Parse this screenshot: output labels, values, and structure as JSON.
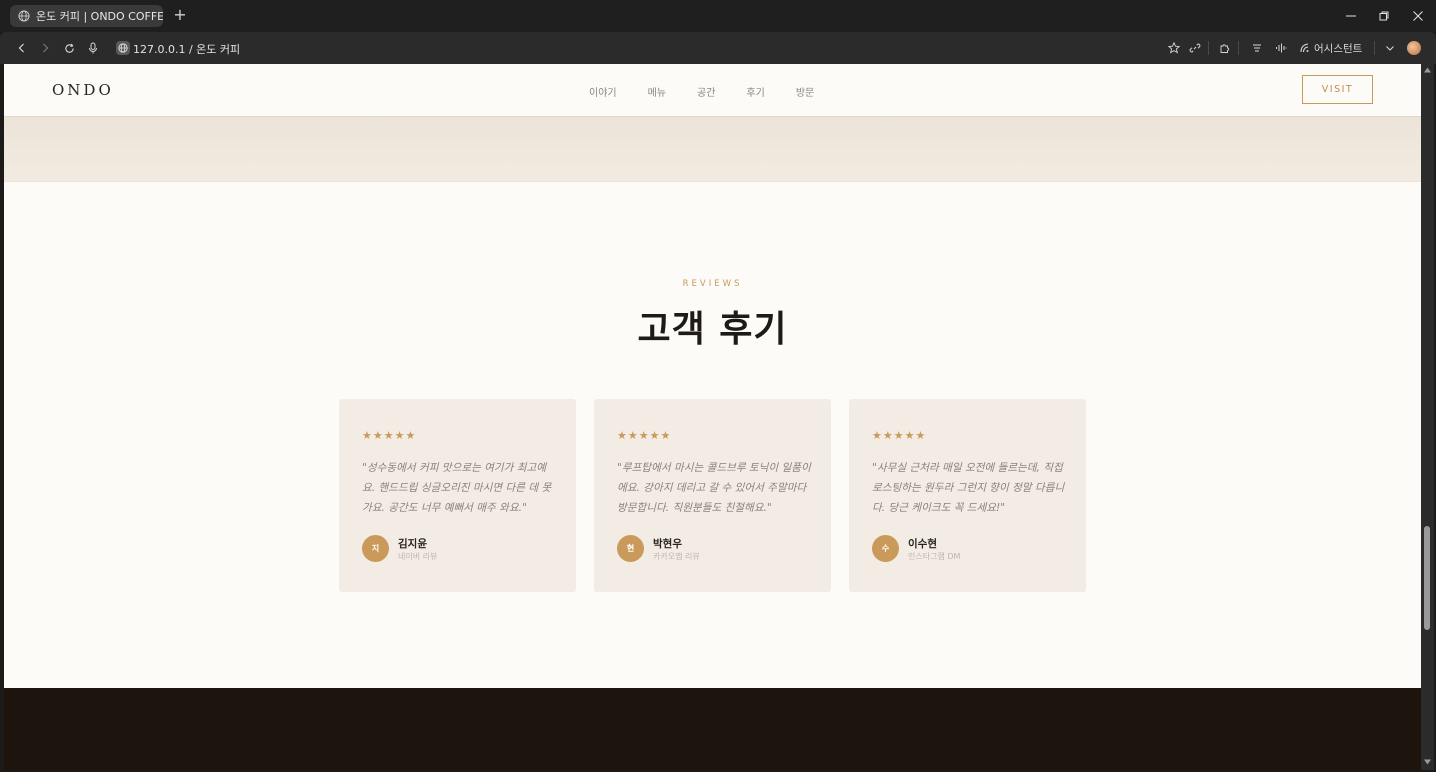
{
  "browser": {
    "tab_title": "온도 커피 | ONDO COFFEE",
    "url": "127.0.0.1 / 온도 커피",
    "assistant_label": "어시스턴트"
  },
  "site": {
    "logo": "ONDO",
    "nav": [
      "이야기",
      "메뉴",
      "공간",
      "후기",
      "방문"
    ],
    "visit_label": "VISIT"
  },
  "reviews": {
    "eyebrow": "REVIEWS",
    "title": "고객 후기",
    "items": [
      {
        "stars": "★★★★★",
        "rating": 5,
        "quote": "\"성수동에서 커피 맛으로는 여기가 최고예요. 핸드드립 싱글오리진 마시면 다른 데 못 가요. 공간도 너무 예뻐서 매주 와요.\"",
        "initial": "지",
        "name": "김지윤",
        "source": "네이버 리뷰"
      },
      {
        "stars": "★★★★★",
        "rating": 5,
        "quote": "\"루프탑에서 마시는 콜드브루 토닉이 일품이에요. 강아지 데리고 갈 수 있어서 주말마다 방문합니다. 직원분들도 친절해요.\"",
        "initial": "현",
        "name": "박현우",
        "source": "카카오맵 리뷰"
      },
      {
        "stars": "★★★★★",
        "rating": 5,
        "quote": "\"사무실 근처라 매일 오전에 들르는데, 직접 로스팅하는 원두라 그런지 향이 정말 다릅니다. 당근 케이크도 꼭 드세요!\"",
        "initial": "수",
        "name": "이수현",
        "source": "인스타그램 DM"
      }
    ]
  },
  "colors": {
    "accent": "#c99a5a",
    "background": "#fdfbf7",
    "card": "#f3ece4",
    "footer": "#1e140e"
  }
}
